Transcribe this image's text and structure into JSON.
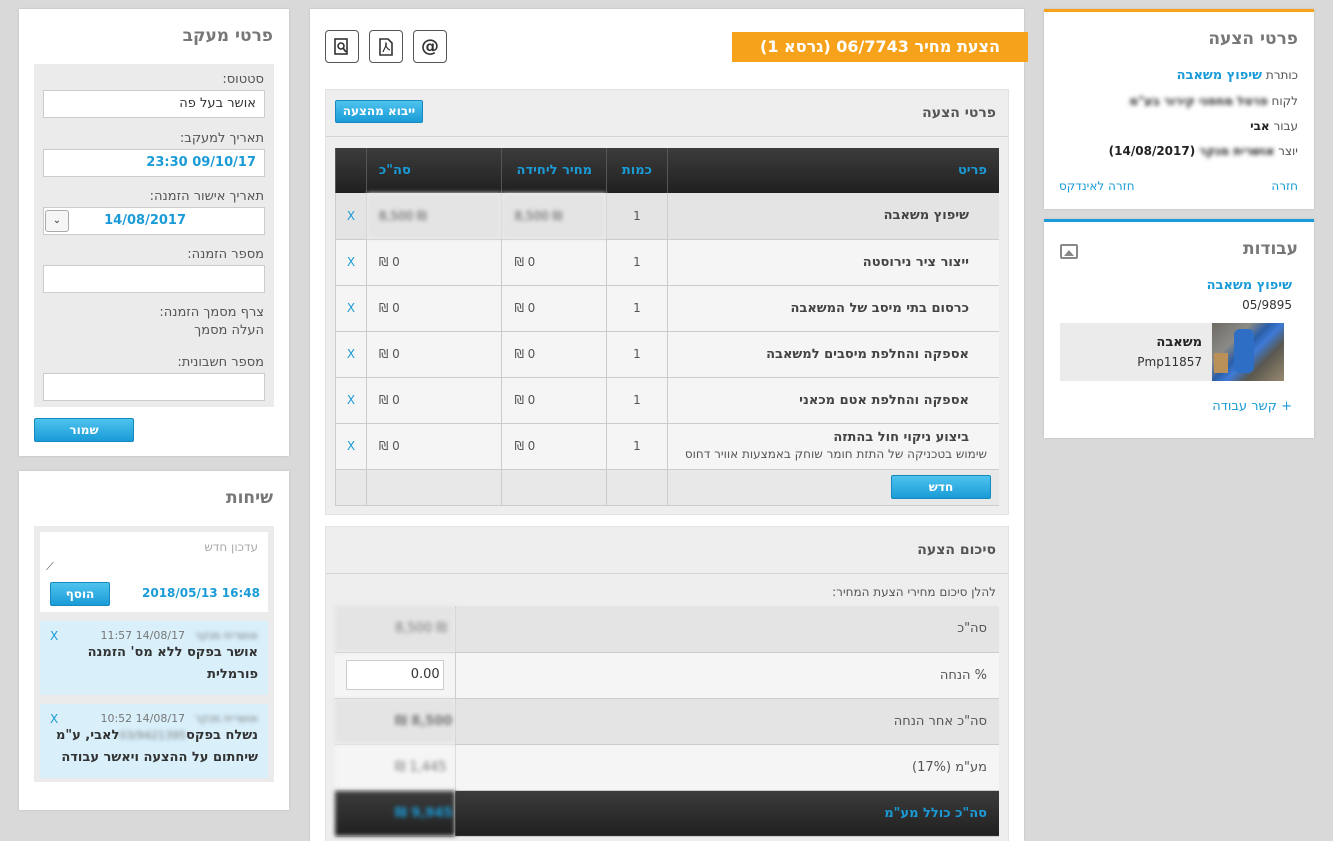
{
  "quote_panel": {
    "title": "פרטי הצעה",
    "subject_label": "כותרת",
    "subject_value": "שיפוץ משאבה",
    "client_label": "לקוח",
    "client_value": "פרטל מחסני קירור בע\"מ",
    "for_label": "עבור",
    "for_value": "אבי",
    "creator_label": "יוצר",
    "creator_name": "אושרית מנקר",
    "creator_date": "(14/08/2017)",
    "back_link": "חזרה",
    "back_index_link": "חזרה לאינדקס"
  },
  "works_panel": {
    "title": "עבודות",
    "work_title": "שיפוץ משאבה",
    "work_number": "05/9895",
    "card_name": "משאבה",
    "card_code": "Pmp11857",
    "link_work": "+ קשר עבודה"
  },
  "main": {
    "title_badge": "הצעת מחיר 06/7743 (גרסא 1)",
    "tool_email_icon": "@",
    "items_section_title": "פרטי הצעה",
    "import_button": "ייבוא מהצעה",
    "columns": {
      "item": "פריט",
      "qty": "כמות",
      "unit_price": "מחיר ליחידה",
      "total": "סה\"כ"
    },
    "items": [
      {
        "name": "שיפוץ משאבה",
        "desc": "",
        "qty": "1",
        "unit": "₪ 8,500",
        "total": "₪ 8,500",
        "remove": "X"
      },
      {
        "name": "ייצור ציר נירוסטה",
        "desc": "",
        "qty": "1",
        "unit": "0 ₪",
        "total": "0 ₪",
        "remove": "X"
      },
      {
        "name": "כרסום בתי מיסב של המשאבה",
        "desc": "",
        "qty": "1",
        "unit": "0 ₪",
        "total": "0 ₪",
        "remove": "X"
      },
      {
        "name": "אספקה והחלפת מיסבים למשאבה",
        "desc": "",
        "qty": "1",
        "unit": "0 ₪",
        "total": "0 ₪",
        "remove": "X"
      },
      {
        "name": "אספקה והחלפת אטם מכאני",
        "desc": "",
        "qty": "1",
        "unit": "0 ₪",
        "total": "0 ₪",
        "remove": "X"
      },
      {
        "name": "ביצוע ניקוי חול בהתזה",
        "desc": "שימוש בטכניקה של התזת חומר שוחק באמצעות אוויר דחוס",
        "qty": "1",
        "unit": "0 ₪",
        "total": "0 ₪",
        "remove": "X"
      }
    ],
    "new_button": "חדש",
    "summary_title": "סיכום הצעה",
    "summary_intro": "להלן סיכום מחירי הצעת המחיר:",
    "summary": {
      "subtotal_label": "סה\"כ",
      "subtotal_value": "₪ 8,500",
      "discount_label": "% הנחה",
      "discount_value": "0.00",
      "after_discount_label": "סה\"כ אחר הנחה",
      "after_discount_value": "8,500 ₪",
      "vat_label": "מע\"מ (17%)",
      "vat_value": "1,445 ₪",
      "total_label": "סה\"כ כולל מע\"מ",
      "total_value": "9,945 ₪"
    }
  },
  "tracking": {
    "title": "פרטי מעקב",
    "status_label": "סטטוס:",
    "status_value": "אושר בעל פה",
    "followup_label": "תאריך למעקב:",
    "followup_value": "09/10/17 23:30",
    "order_approval_label": "תאריך אישור הזמנה:",
    "order_approval_value": "14/08/2017",
    "order_number_label": "מספר הזמנה:",
    "order_number_value": "",
    "attach_label": "צרף מסמך הזמנה:",
    "attach_link": "העלה מסמך",
    "invoice_label": "מספר חשבונית:",
    "invoice_value": "",
    "save_button": "שמור"
  },
  "chat": {
    "title": "שיחות",
    "new_update_placeholder": "עדכון חדש",
    "timestamp": "2018/05/13 16:48",
    "add_button": "הוסף",
    "messages": [
      {
        "author": "אושרית מנקר",
        "time": "14/08/17 11:57",
        "text": "אושר בפקס ללא מס' הזמנה פורמלית",
        "remove": "X"
      },
      {
        "author": "אושרית מנקר",
        "time": "14/08/17 10:52",
        "text_a": "נשלח בפקס",
        "text_blur": "03/9421395",
        "text_b": "לאבי, ע\"מ שיחתום על ההצעה ויאשר עבודה",
        "remove": "X"
      }
    ]
  }
}
